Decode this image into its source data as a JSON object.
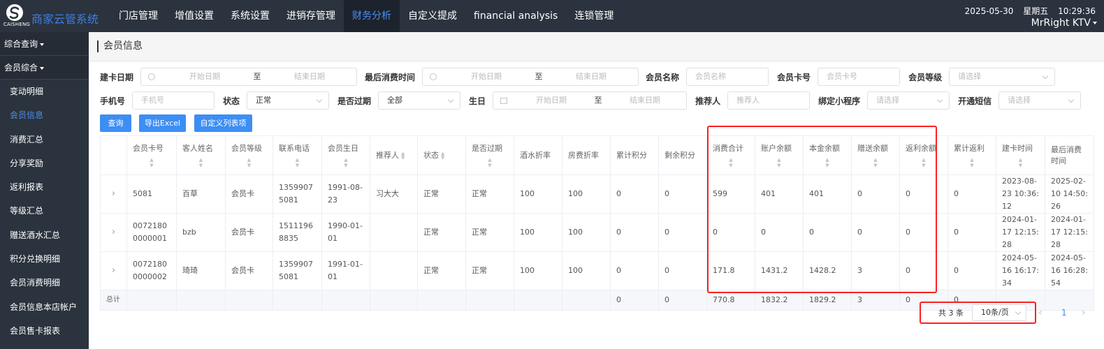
{
  "app": {
    "logo_text": "CAISHENG",
    "brand": "商家云管系统",
    "nav": [
      "门店管理",
      "增值设置",
      "系统设置",
      "进销存管理",
      "财务分析",
      "自定义提成",
      "financial analysis",
      "连锁管理"
    ],
    "active_nav": "财务分析",
    "date": "2025-05-30",
    "weekday": "星期五",
    "time": "10:29:36",
    "store": "MrRight KTV"
  },
  "sidebar": {
    "groups": [
      "综合查询",
      "会员综合"
    ],
    "items": [
      "变动明细",
      "会员信息",
      "消费汇总",
      "分享奖励",
      "返利报表",
      "等级汇总",
      "赠送酒水汇总",
      "积分兑换明细",
      "会员消费明细",
      "会员信息本店帐户",
      "会员售卡报表"
    ],
    "active_item": "会员信息"
  },
  "page": {
    "title": "会员信息"
  },
  "filters": {
    "card_date": {
      "label": "建卡日期",
      "start": "开始日期",
      "sep": "至",
      "end": "结束日期"
    },
    "last_consume": {
      "label": "最后消费时间",
      "start": "开始日期",
      "sep": "至",
      "end": "结束日期"
    },
    "member_name": {
      "label": "会员名称",
      "placeholder": "会员名称"
    },
    "card_no": {
      "label": "会员卡号",
      "placeholder": "会员卡号"
    },
    "level": {
      "label": "会员等级",
      "placeholder": "请选择"
    },
    "phone": {
      "label": "手机号",
      "placeholder": "手机号"
    },
    "status": {
      "label": "状态",
      "value": "正常"
    },
    "expired": {
      "label": "是否过期",
      "value": "全部"
    },
    "birthday": {
      "label": "生日",
      "start": "开始日期",
      "sep": "至",
      "end": "结束日期"
    },
    "referrer": {
      "label": "推荐人",
      "placeholder": "推荐人"
    },
    "miniprogram": {
      "label": "绑定小程序",
      "placeholder": "请选择"
    },
    "sms": {
      "label": "开通短信",
      "placeholder": "请选择"
    }
  },
  "buttons": {
    "query": "查询",
    "export": "导出Excel",
    "custom_cols": "自定义列表项"
  },
  "table": {
    "headers": [
      "会员卡号",
      "客人姓名",
      "会员等级",
      "联系电话",
      "会员生日",
      "推荐人",
      "状态",
      "是否过期",
      "酒水折率",
      "房费折率",
      "累计积分",
      "剩余积分",
      "消费合计",
      "账户余额",
      "本金余额",
      "赠送余额",
      "返利余额",
      "累计返利",
      "建卡时间",
      "最后消费时间"
    ],
    "rows": [
      [
        "5081",
        "百草",
        "会员卡",
        "13599075081",
        "1991-08-23",
        "习大大",
        "正常",
        "正常",
        "100",
        "100",
        "0",
        "0",
        "599",
        "401",
        "401",
        "0",
        "0",
        "0",
        "2023-08-23 10:36:12",
        "2025-02-10 14:50:26"
      ],
      [
        "00721800000001",
        "bzb",
        "会员卡",
        "15111968835",
        "1990-01-01",
        "",
        "正常",
        "正常",
        "100",
        "100",
        "0",
        "0",
        "0",
        "0",
        "0",
        "0",
        "0",
        "0",
        "2024-01-17 12:15:28",
        "2024-01-17 12:15:28"
      ],
      [
        "00721800000002",
        "琦琦",
        "会员卡",
        "13599075081",
        "1991-01-01",
        "",
        "正常",
        "正常",
        "100",
        "100",
        "0",
        "0",
        "171.8",
        "1431.2",
        "1428.2",
        "3",
        "0",
        "0",
        "2024-05-16 16:17:34",
        "2024-05-16 16:28:54"
      ]
    ],
    "total": {
      "label": "总计",
      "values": [
        "",
        "",
        "",
        "",
        "",
        "",
        "",
        "",
        "",
        "",
        "0",
        "0",
        "770.8",
        "1832.2",
        "1829.2",
        "3",
        "0",
        "0",
        "",
        ""
      ]
    }
  },
  "pagination": {
    "total_text": "共 3 条",
    "page_size": "10条/页",
    "page": "1"
  }
}
